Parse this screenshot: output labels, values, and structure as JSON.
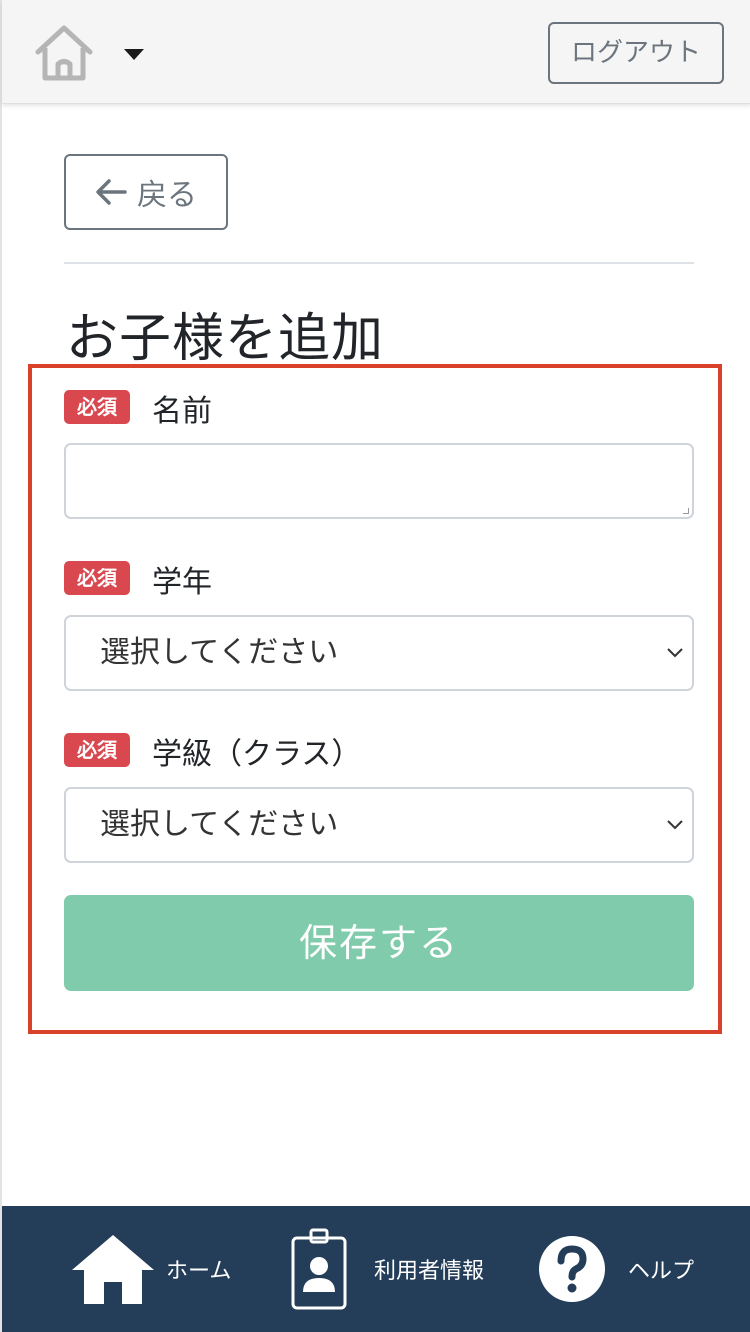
{
  "header": {
    "home_icon": "home-icon",
    "dropdown_icon": "caret-down-icon",
    "logout_label": "ログアウト"
  },
  "back": {
    "icon": "arrow-left-icon",
    "label": "戻る"
  },
  "page_title": "お子様を追加",
  "form": {
    "required_badge": "必須",
    "name": {
      "label": "名前",
      "value": ""
    },
    "grade": {
      "label": "学年",
      "selected": "選択してください"
    },
    "class": {
      "label": "学級（クラス）",
      "selected": "選択してください"
    },
    "save_label": "保存する"
  },
  "bottom_nav": {
    "home": {
      "label": "ホーム",
      "icon": "house-icon"
    },
    "user_info": {
      "label": "利用者情報",
      "icon": "id-badge-icon"
    },
    "help": {
      "label": "ヘルプ",
      "icon": "question-circle-icon"
    }
  },
  "colors": {
    "header_bg": "#f5f5f5",
    "required_badge": "#d9474f",
    "save_button": "#80cbab",
    "highlight_border": "#d9412b",
    "bottom_nav_bg": "#243e5a"
  }
}
